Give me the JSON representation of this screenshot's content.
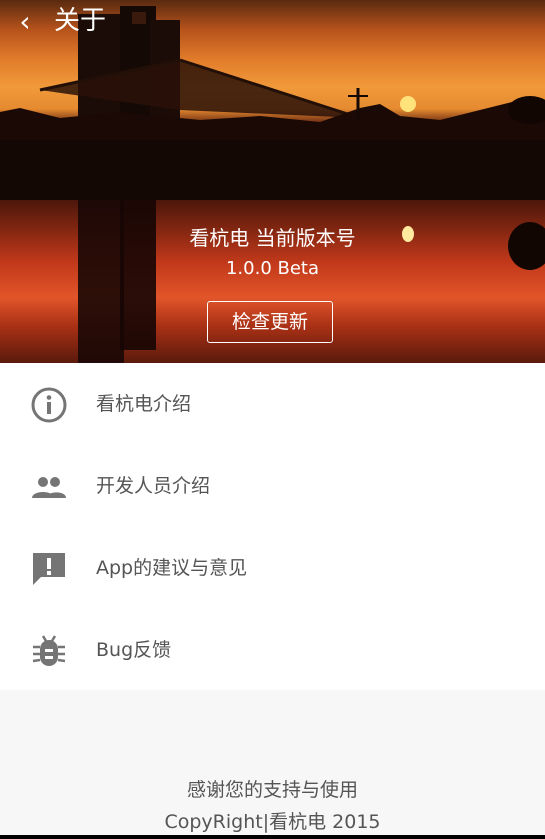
{
  "header": {
    "back_icon": "chevron-left-icon",
    "title": "关于"
  },
  "hero": {
    "app_name": "看杭电 当前版本号",
    "version": "1.0.0 Beta",
    "check_update_label": "检查更新"
  },
  "menu": [
    {
      "icon": "info-icon",
      "label": "看杭电介绍"
    },
    {
      "icon": "people-icon",
      "label": "开发人员介绍"
    },
    {
      "icon": "feedback-icon",
      "label": "App的建议与意见"
    },
    {
      "icon": "bug-icon",
      "label": "Bug反馈"
    }
  ],
  "footer": {
    "thanks": "感谢您的支持与使用",
    "copyright": "CopyRight|看杭电 2015"
  },
  "colors": {
    "icon": "#757575",
    "text": "#555555",
    "accent": "#ffffff"
  }
}
